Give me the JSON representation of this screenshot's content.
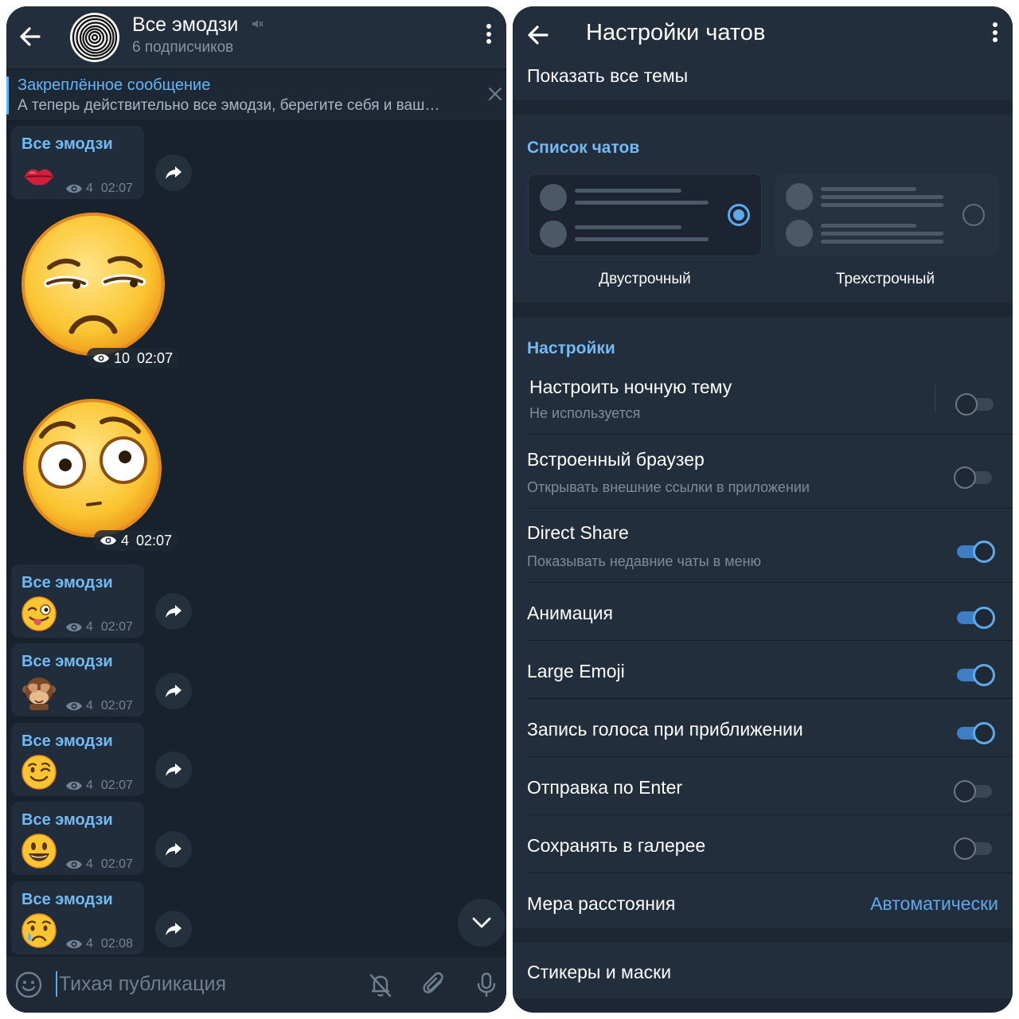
{
  "left": {
    "channel_title": "Все эмодзи",
    "subscribers": "6 подписчиков",
    "pinned": {
      "title": "Закреплённое сообщение",
      "text": "А теперь действительно все эмодзи, берегите себя и ваш…"
    },
    "messages": [
      {
        "type": "bubble",
        "sender": "Все эмодзи",
        "emoji": "kiss-mark",
        "views": "4",
        "time": "02:07"
      },
      {
        "type": "big",
        "emoji": "unamused-face",
        "views": "10",
        "time": "02:07"
      },
      {
        "type": "big",
        "emoji": "flushed-face",
        "views": "4",
        "time": "02:07"
      },
      {
        "type": "bubble",
        "sender": "Все эмодзи",
        "emoji": "winking-tongue-face",
        "views": "4",
        "time": "02:07"
      },
      {
        "type": "bubble",
        "sender": "Все эмодзи",
        "emoji": "see-no-evil-monkey",
        "views": "4",
        "time": "02:07"
      },
      {
        "type": "bubble",
        "sender": "Все эмодзи",
        "emoji": "winking-face",
        "views": "4",
        "time": "02:07"
      },
      {
        "type": "bubble",
        "sender": "Все эмодзи",
        "emoji": "smiley-face",
        "views": "4",
        "time": "02:07"
      },
      {
        "type": "bubble",
        "sender": "Все эмодзи",
        "emoji": "crying-face",
        "views": "4",
        "time": "02:08"
      }
    ],
    "input_placeholder": "Тихая публикация"
  },
  "right": {
    "title": "Настройки чатов",
    "top_item": "Показать все темы",
    "chat_list": {
      "heading": "Список чатов",
      "options": [
        {
          "label": "Двустрочный",
          "selected": true
        },
        {
          "label": "Трехстрочный",
          "selected": false
        }
      ]
    },
    "settings": {
      "heading": "Настройки",
      "night_theme": {
        "title": "Настроить ночную тему",
        "subtitle": "Не используется",
        "enabled": false
      },
      "in_app_browser": {
        "title": "Встроенный браузер",
        "subtitle": "Открывать внешние ссылки в приложении",
        "enabled": false
      },
      "direct_share": {
        "title": "Direct Share",
        "subtitle": "Показывать недавние чаты в меню",
        "enabled": true
      },
      "animation": {
        "title": "Анимация",
        "enabled": true
      },
      "large_emoji": {
        "title": "Large Emoji",
        "enabled": true
      },
      "raise_to_speak": {
        "title": "Запись голоса при приближении",
        "enabled": true
      },
      "send_by_enter": {
        "title": "Отправка по Enter",
        "enabled": false
      },
      "save_to_gallery": {
        "title": "Сохранять в галерее",
        "enabled": false
      },
      "distance_units": {
        "title": "Мера расстояния",
        "value": "Автоматически"
      }
    },
    "bottom_item": "Стикеры и маски"
  },
  "colors": {
    "accent": "#5ea9ea",
    "link": "#71baf5",
    "background": "#18222d",
    "header": "#232e3c"
  }
}
